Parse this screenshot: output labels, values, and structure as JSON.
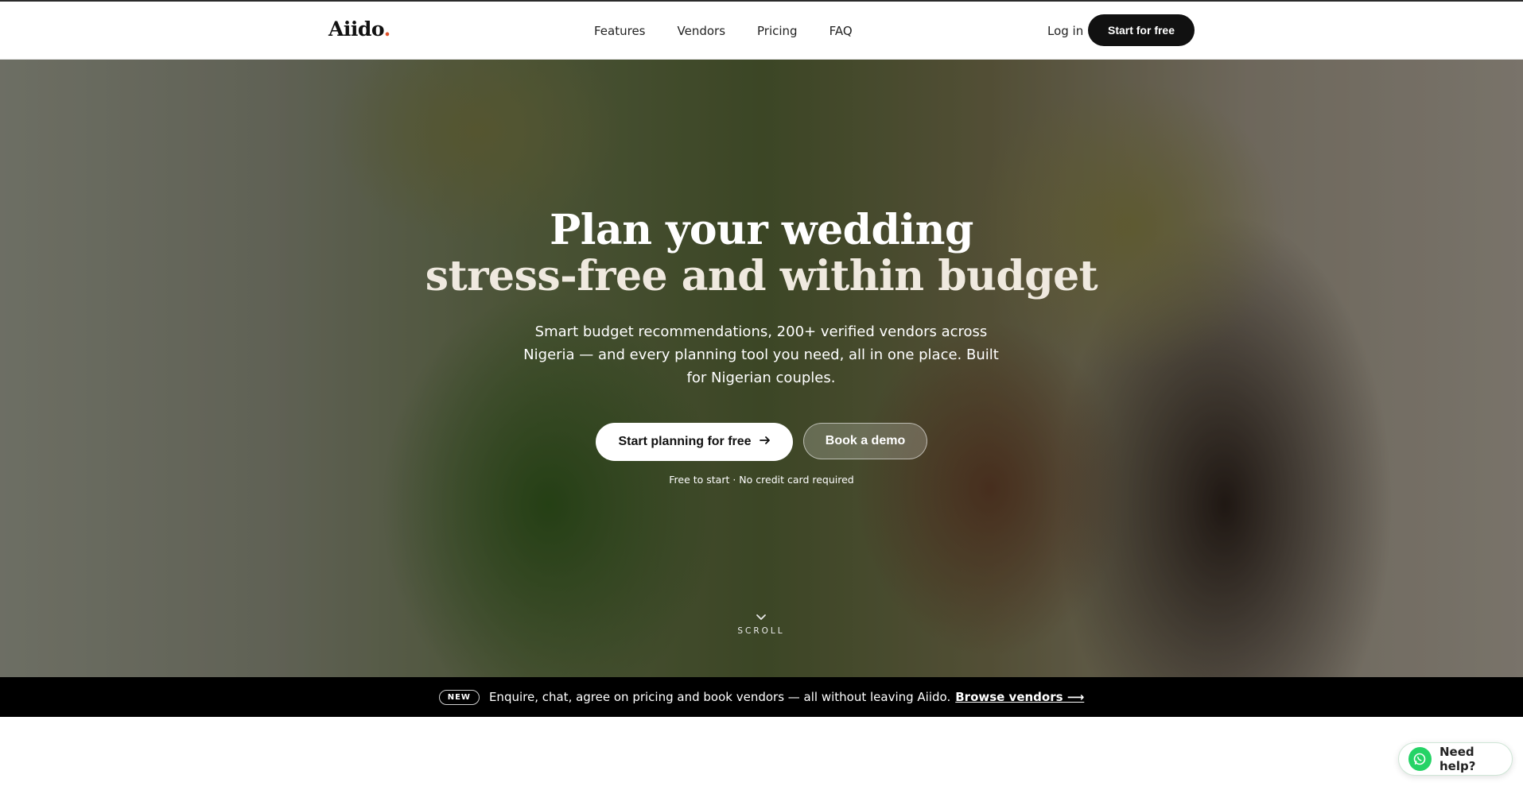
{
  "nav": {
    "logo_text": "Aiido",
    "logo_dot": ".",
    "links": [
      "Features",
      "Vendors",
      "Pricing",
      "FAQ"
    ],
    "login": "Log in",
    "cta": "Start for free"
  },
  "hero": {
    "title_line1": "Plan your wedding",
    "title_line2": "stress-free and within budget",
    "subtitle": "Smart budget recommendations, 200+ verified vendors across Nigeria — and every planning tool you need, all in one place. Built for Nigerian couples.",
    "primary_cta": "Start planning for free",
    "primary_cta_icon": "arrow-right-icon",
    "secondary_cta": "Book a demo",
    "note": "Free to start · No credit card required",
    "scroll_label": "SCROLL",
    "scroll_icon": "chevron-down-icon"
  },
  "banner": {
    "badge": "NEW",
    "text": "Enquire, chat, agree on pricing and book vendors — all without leaving Aiido.",
    "link": "Browse vendors ⟶"
  },
  "help": {
    "label": "Need help?",
    "icon": "whatsapp-icon"
  },
  "colors": {
    "brand_dark": "#111111",
    "logo_accent": "#e0522c",
    "whatsapp": "#25d366"
  }
}
